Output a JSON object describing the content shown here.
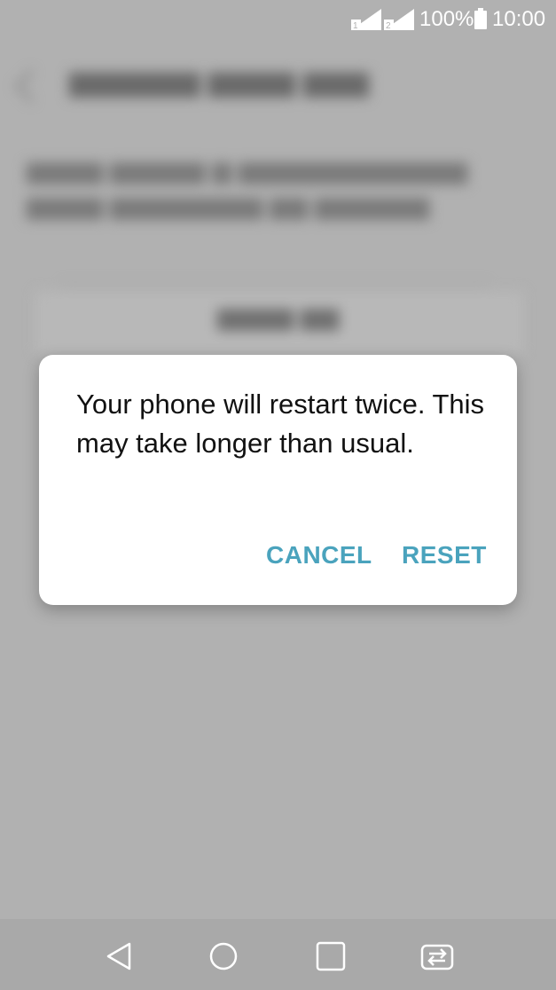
{
  "status_bar": {
    "battery_percent": "100%",
    "time": "10:00",
    "icons": [
      "signal-sim1-icon",
      "signal-sim2-icon",
      "battery-icon"
    ]
  },
  "dialog": {
    "message": "Your phone will restart twice. This may take longer than usual.",
    "cancel_label": "CANCEL",
    "reset_label": "RESET"
  },
  "colors": {
    "accent": "#4aa3bd",
    "scrim": "#b1b1b1",
    "dialog_bg": "#ffffff"
  },
  "nav_bar": {
    "icons": [
      "back-icon",
      "home-icon",
      "recents-icon",
      "switch-sim-icon"
    ]
  }
}
